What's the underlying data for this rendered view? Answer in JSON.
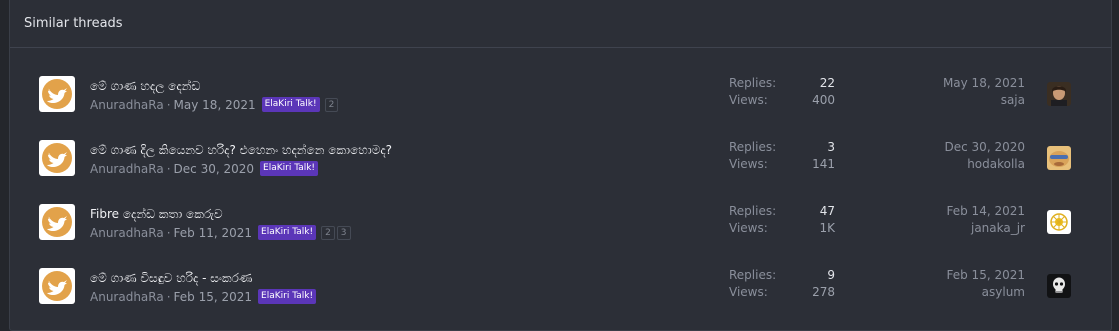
{
  "header": {
    "title": "Similar threads"
  },
  "threads": [
    {
      "title": "මේ ගාණ හදල දෙන්ඩ",
      "author": "AnuradhaRa",
      "date": "May 18, 2021",
      "prefix": "ElaKiri Talk!",
      "pages": [
        "2"
      ],
      "replies_label": "Replies:",
      "replies": "22",
      "views_label": "Views:",
      "views": "400",
      "last_date": "May 18, 2021",
      "last_user": "saja"
    },
    {
      "title": "මේ ගාණ දිල කියෙනව හරිද? එහෙනං හදන්නෙ කොහොමද?",
      "author": "AnuradhaRa",
      "date": "Dec 30, 2020",
      "prefix": "ElaKiri Talk!",
      "pages": [],
      "replies_label": "Replies:",
      "replies": "3",
      "views_label": "Views:",
      "views": "141",
      "last_date": "Dec 30, 2020",
      "last_user": "hodakolla"
    },
    {
      "title": "Fibre දෙන්ඩ කතා කෙරුව",
      "author": "AnuradhaRa",
      "date": "Feb 11, 2021",
      "prefix": "ElaKiri Talk!",
      "pages": [
        "2",
        "3"
      ],
      "replies_label": "Replies:",
      "replies": "47",
      "views_label": "Views:",
      "views": "1K",
      "last_date": "Feb 14, 2021",
      "last_user": "janaka_jr"
    },
    {
      "title": "මේ ගාණ විසඳුව හරිද - සංකරණ",
      "author": "AnuradhaRa",
      "date": "Feb 15, 2021",
      "prefix": "ElaKiri Talk!",
      "pages": [],
      "replies_label": "Replies:",
      "replies": "9",
      "views_label": "Views:",
      "views": "278",
      "last_date": "Feb 15, 2021",
      "last_user": "asylum"
    }
  ],
  "colors": {
    "accent_prefix": "#5b36b8",
    "avatar_bird": "#e2a24a",
    "background": "#2c2f37"
  },
  "icons": [
    "twitter-bird-avatar-icon"
  ]
}
